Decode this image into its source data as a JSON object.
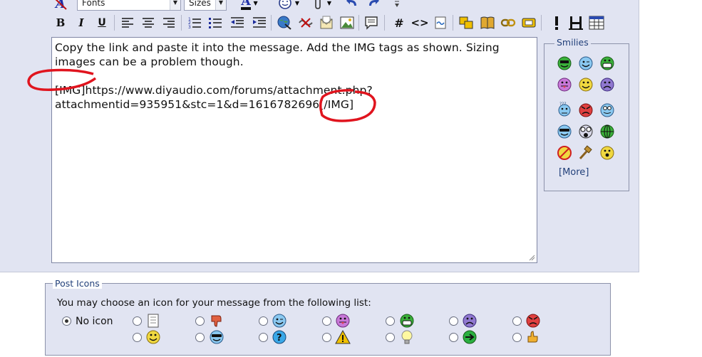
{
  "toolbar": {
    "font_select": "Fonts",
    "size_select": "Sizes",
    "bold": "B",
    "italic": "I",
    "underline": "U",
    "hash": "#",
    "code": "<>",
    "text_color_glyph": "A"
  },
  "editor": {
    "line1": "Copy the link and paste it into the message. Add the IMG tags as shown. Sizing",
    "line2": "images can be a problem though.",
    "line3": "[IMG]https://www.diyaudio.com/forums/attachment.php?",
    "line4": "attachmentid=935951&stc=1&d=1616782696[/IMG]"
  },
  "smilies": {
    "legend": "Smilies",
    "more_open": "[",
    "more_link": "More",
    "more_close": "]"
  },
  "post_icons": {
    "legend": "Post Icons",
    "instruction": "You may choose an icon for your message from the following list:",
    "no_icon_label": "No icon"
  },
  "colors": {
    "panel_bg": "#e1e4f2",
    "legend_text": "#22407a",
    "annotation_red": "#e0141e"
  }
}
